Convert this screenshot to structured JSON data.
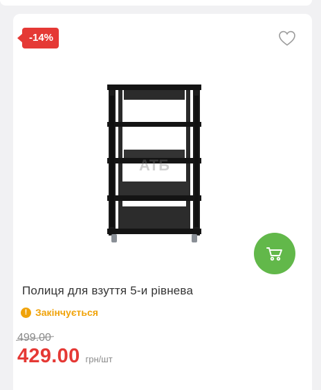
{
  "badge": {
    "discount": "-14%"
  },
  "product": {
    "title": "Полиця для взуття 5-и рівнева",
    "watermark": "АТБ",
    "image_icon": "shoe-rack-image"
  },
  "stock": {
    "status": "Закінчується",
    "icon": "warning-icon"
  },
  "price": {
    "old": "499.00",
    "current": "429.00",
    "unit": "грн/шт"
  },
  "actions": {
    "favorite_icon": "heart-icon",
    "cart_icon": "cart-icon"
  },
  "colors": {
    "accent": "#e53935",
    "cart": "#62b84a",
    "warning": "#f0a30a"
  }
}
